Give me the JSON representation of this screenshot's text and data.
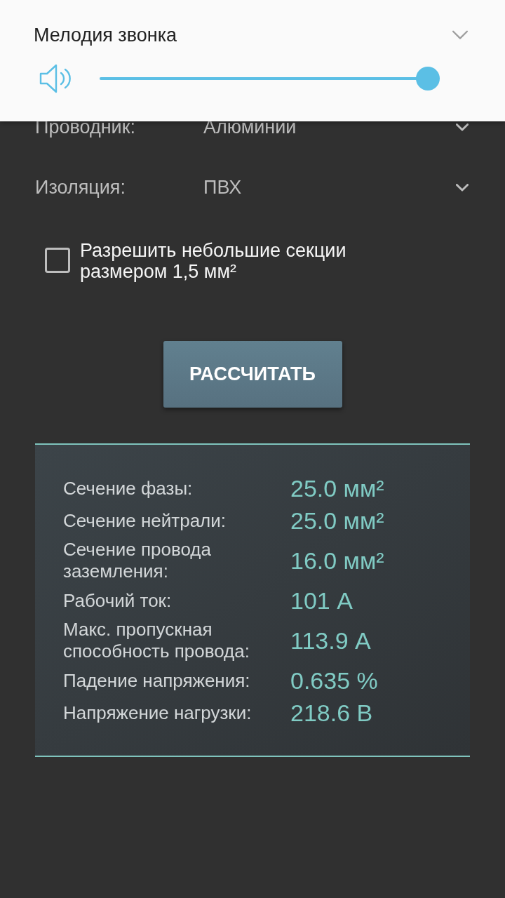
{
  "volume_panel": {
    "title": "Мелодия звонка",
    "slider": {
      "level": 1
    }
  },
  "fields": [
    {
      "label": "Проводник:",
      "value": "Алюминии"
    },
    {
      "label": "Изоляция:",
      "value": "ПВХ"
    }
  ],
  "option": {
    "label": "Разрешить небольшие секции размером 1,5 мм²",
    "checked": false
  },
  "button": {
    "label": "РАССЧИТАТЬ"
  },
  "results": [
    {
      "label": "Сечение фазы:",
      "value": "25.0 мм²"
    },
    {
      "label": "Сечение нейтрали:",
      "value": "25.0 мм²"
    },
    {
      "label": "Сечение провода заземления:",
      "value": "16.0 мм²"
    },
    {
      "label": "Рабочий ток:",
      "value": "101 А"
    },
    {
      "label": "Макс. пропускная способность провода:",
      "value": "113.9 А"
    },
    {
      "label": "Падение напряжения:",
      "value": "0.635 %"
    },
    {
      "label": "Напряжение нагрузки:",
      "value": "218.6 В"
    }
  ]
}
